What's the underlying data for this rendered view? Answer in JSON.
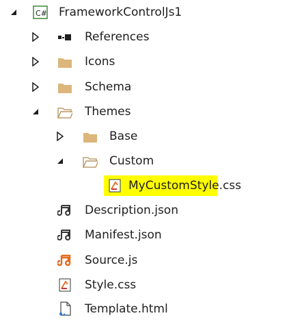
{
  "tree": {
    "project": {
      "label": "FrameworkControlJs1",
      "icon": "csharp-project-icon"
    },
    "items": [
      {
        "label": "References",
        "icon": "references-icon",
        "expanded": false
      },
      {
        "label": "Icons",
        "icon": "folder-icon",
        "expanded": false
      },
      {
        "label": "Schema",
        "icon": "folder-icon",
        "expanded": false
      },
      {
        "label": "Themes",
        "icon": "folder-open-icon",
        "expanded": true
      },
      {
        "label": "Base",
        "icon": "folder-icon",
        "expanded": false
      },
      {
        "label": "Custom",
        "icon": "folder-open-icon",
        "expanded": true
      },
      {
        "label": "MyCustomStyle.css",
        "icon": "css-file-icon",
        "selected": true
      },
      {
        "label": "Description.json",
        "icon": "json-file-icon"
      },
      {
        "label": "Manifest.json",
        "icon": "json-file-icon"
      },
      {
        "label": "Source.js",
        "icon": "js-file-icon"
      },
      {
        "label": "Style.css",
        "icon": "css-file-icon"
      },
      {
        "label": "Template.html",
        "icon": "html-file-icon"
      }
    ]
  },
  "colors": {
    "selection": "#ffff00",
    "folder": "#dcb67a",
    "accent_orange": "#e46a1b"
  }
}
